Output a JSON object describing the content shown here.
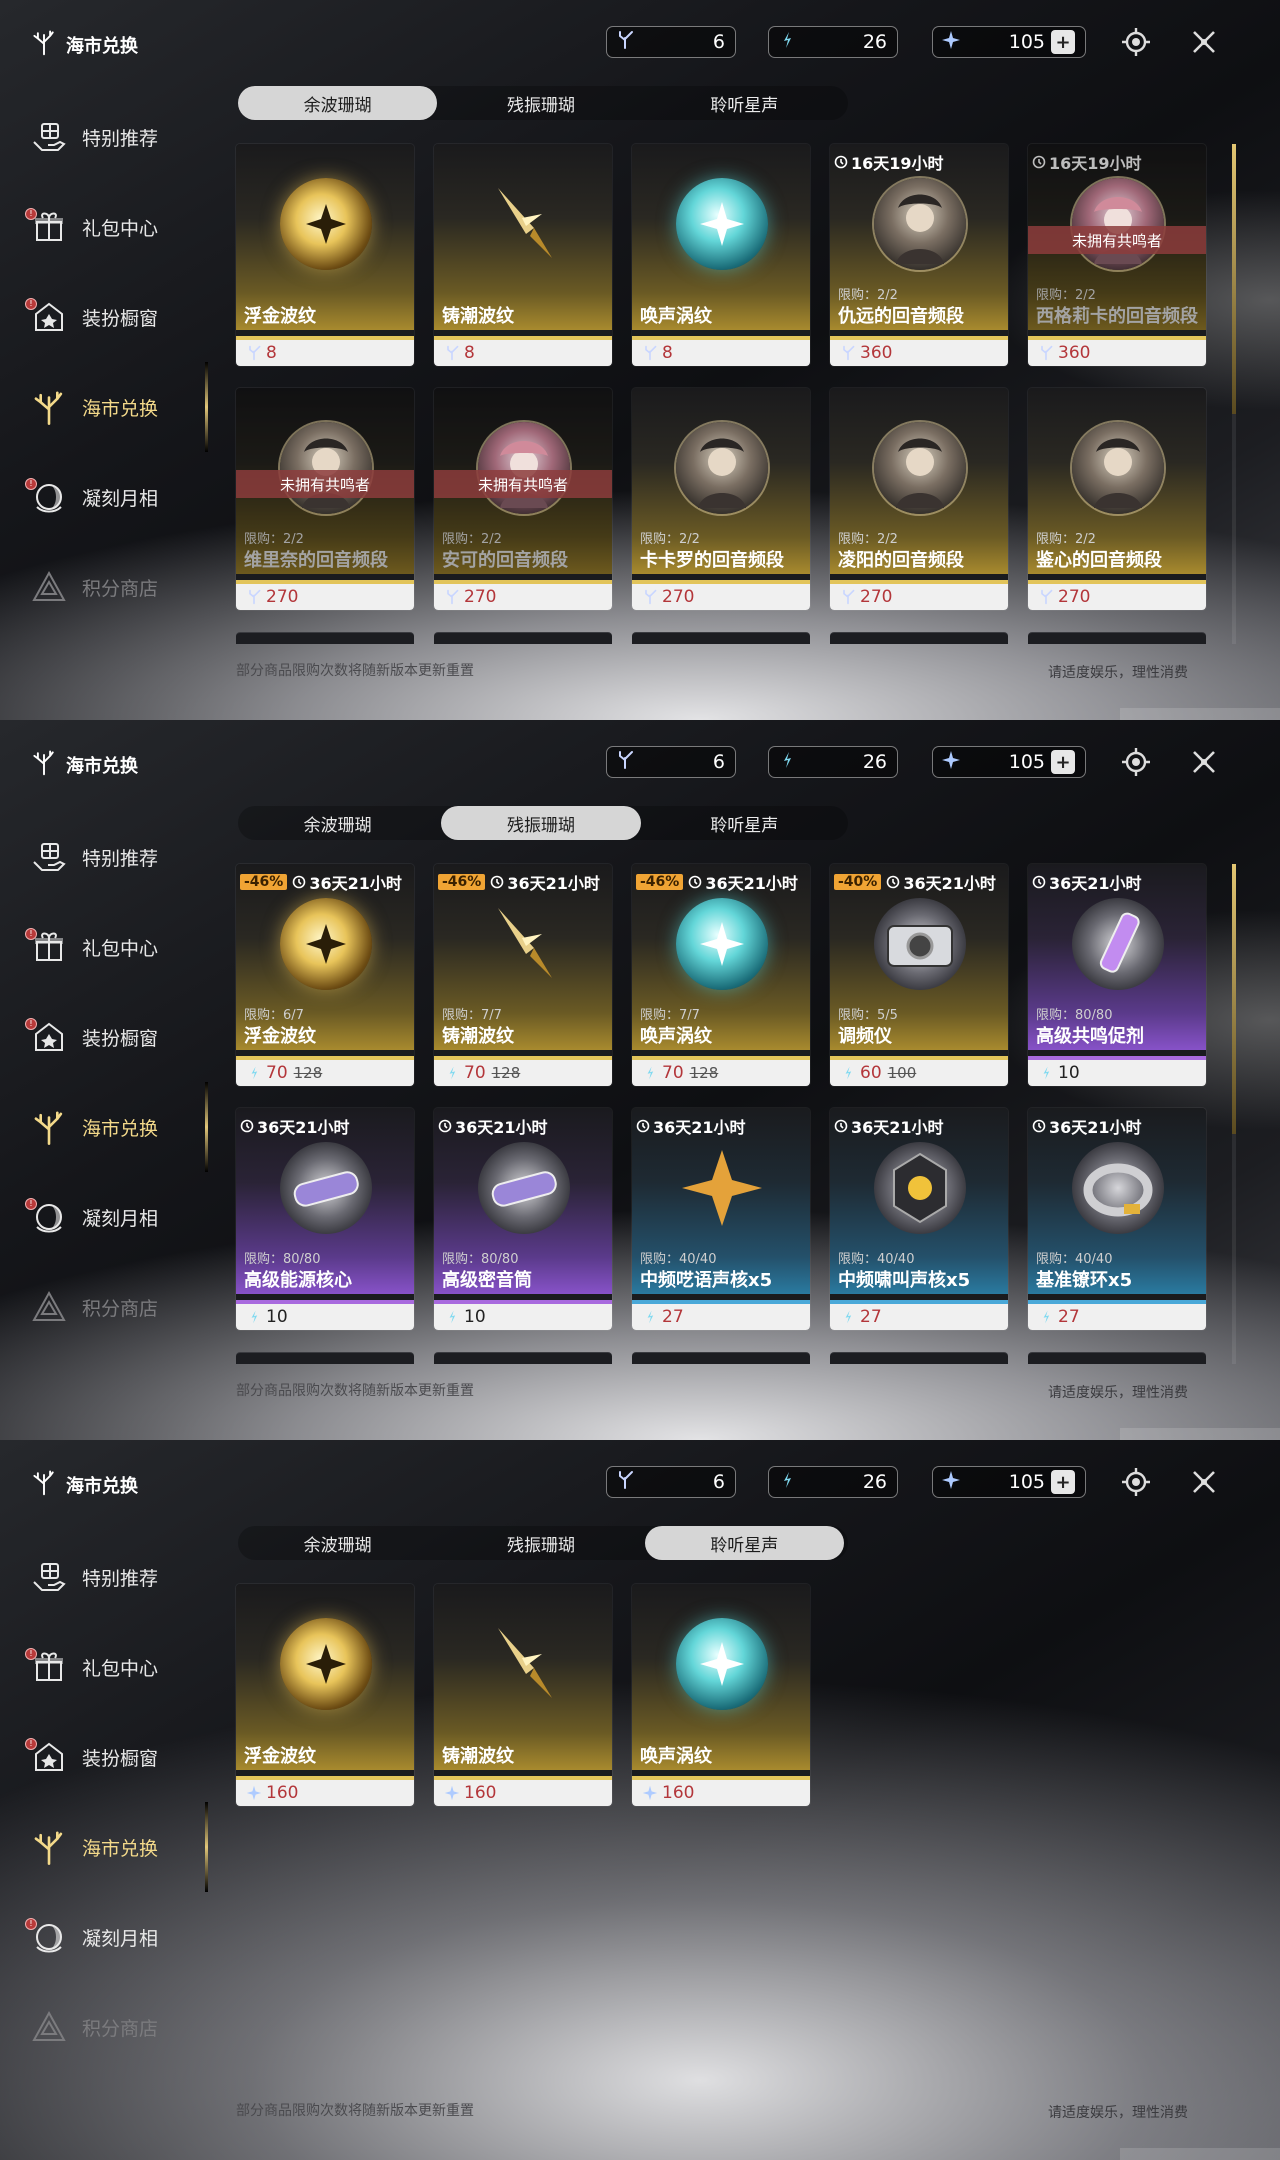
{
  "brand": {
    "title": "海市兑换"
  },
  "nav": [
    {
      "label": "特别推荐",
      "icon": "hand-gift-icon",
      "state": "normal",
      "dot": false
    },
    {
      "label": "礼包中心",
      "icon": "gift-box-icon",
      "state": "normal",
      "dot": true
    },
    {
      "label": "装扮橱窗",
      "icon": "wardrobe-icon",
      "state": "normal",
      "dot": true
    },
    {
      "label": "海市兑换",
      "icon": "coral-icon",
      "state": "active",
      "dot": false
    },
    {
      "label": "凝刻月相",
      "icon": "moon-phase-icon",
      "state": "normal",
      "dot": true
    },
    {
      "label": "积分商店",
      "icon": "triangle-icon",
      "state": "disabled",
      "dot": false
    }
  ],
  "currencies": [
    {
      "icon": "afterglow-coral-icon",
      "value": "6"
    },
    {
      "icon": "oscillated-coral-icon",
      "value": "26"
    },
    {
      "icon": "star-sound-icon",
      "value": "105",
      "plus": "+"
    }
  ],
  "tabs": [
    "余波珊瑚",
    "残振珊瑚",
    "聆听星声"
  ],
  "footer": {
    "left": "部分商品限购次数将随新版本更新重置",
    "right": "请适度娱乐，理性消费"
  },
  "screens": [
    {
      "selected_tab": 0,
      "items": [
        {
          "name": "浮金波纹",
          "price": "8",
          "theme": "gold",
          "art": "gold-orb"
        },
        {
          "name": "铸潮波纹",
          "price": "8",
          "theme": "gold",
          "art": "blade"
        },
        {
          "name": "唤声涡纹",
          "price": "8",
          "theme": "gold",
          "art": "teal-orb"
        },
        {
          "name": "仇远的回音频段",
          "price": "360",
          "theme": "gold",
          "art": "portrait",
          "limit": "限购：2/2",
          "timer": "16天19小时"
        },
        {
          "name": "西格莉卡的回音频段",
          "price": "360",
          "theme": "gold",
          "art": "portrait2",
          "limit": "限购：2/2",
          "timer": "16天19小时",
          "overlay": "未拥有共鸣者",
          "dim": true
        },
        {
          "name": "维里奈的回音频段",
          "price": "270",
          "theme": "gold",
          "art": "portrait",
          "limit": "限购：2/2",
          "overlay": "未拥有共鸣者",
          "dim": true
        },
        {
          "name": "安可的回音频段",
          "price": "270",
          "theme": "gold",
          "art": "portrait2",
          "limit": "限购：2/2",
          "overlay": "未拥有共鸣者",
          "dim": true
        },
        {
          "name": "卡卡罗的回音频段",
          "price": "270",
          "theme": "gold",
          "art": "portrait",
          "limit": "限购：2/2"
        },
        {
          "name": "凌阳的回音频段",
          "price": "270",
          "theme": "gold",
          "art": "portrait",
          "limit": "限购：2/2"
        },
        {
          "name": "鉴心的回音频段",
          "price": "270",
          "theme": "gold",
          "art": "portrait",
          "limit": "限购：2/2"
        }
      ]
    },
    {
      "selected_tab": 1,
      "items": [
        {
          "name": "浮金波纹",
          "price": "70",
          "old": "128",
          "theme": "gold",
          "art": "gold-orb",
          "limit": "限购：6/7",
          "timer": "36天21小时",
          "discount": "-46%"
        },
        {
          "name": "铸潮波纹",
          "price": "70",
          "old": "128",
          "theme": "gold",
          "art": "blade",
          "limit": "限购：7/7",
          "timer": "36天21小时",
          "discount": "-46%"
        },
        {
          "name": "唤声涡纹",
          "price": "70",
          "old": "128",
          "theme": "gold",
          "art": "teal-orb",
          "limit": "限购：7/7",
          "timer": "36天21小时",
          "discount": "-46%"
        },
        {
          "name": "调频仪",
          "price": "60",
          "old": "100",
          "theme": "gold",
          "art": "device",
          "limit": "限购：5/5",
          "timer": "36天21小时",
          "discount": "-40%"
        },
        {
          "name": "高级共鸣促剂",
          "price": "10",
          "theme": "purple",
          "art": "vial",
          "limit": "限购：80/80",
          "timer": "36天21小时",
          "black": true
        },
        {
          "name": "高级能源核心",
          "price": "10",
          "theme": "purple",
          "art": "capsule",
          "limit": "限购：80/80",
          "timer": "36天21小时",
          "black": true
        },
        {
          "name": "高级密音筒",
          "price": "10",
          "theme": "purple",
          "art": "capsule",
          "limit": "限购：80/80",
          "timer": "36天21小时",
          "black": true
        },
        {
          "name": "中频呓语声核x5",
          "price": "27",
          "theme": "blue",
          "art": "star",
          "limit": "限购：40/40",
          "timer": "36天21小时"
        },
        {
          "name": "中频啸叫声核x5",
          "price": "27",
          "theme": "blue",
          "art": "core",
          "limit": "限购：40/40",
          "timer": "36天21小时"
        },
        {
          "name": "基准镣环x5",
          "price": "27",
          "theme": "blue",
          "art": "ring",
          "limit": "限购：40/40",
          "timer": "36天21小时"
        }
      ]
    },
    {
      "selected_tab": 2,
      "items": [
        {
          "name": "浮金波纹",
          "price": "160",
          "theme": "gold",
          "art": "gold-orb"
        },
        {
          "name": "铸潮波纹",
          "price": "160",
          "theme": "gold",
          "art": "blade"
        },
        {
          "name": "唤声涡纹",
          "price": "160",
          "theme": "gold",
          "art": "teal-orb"
        }
      ]
    }
  ]
}
